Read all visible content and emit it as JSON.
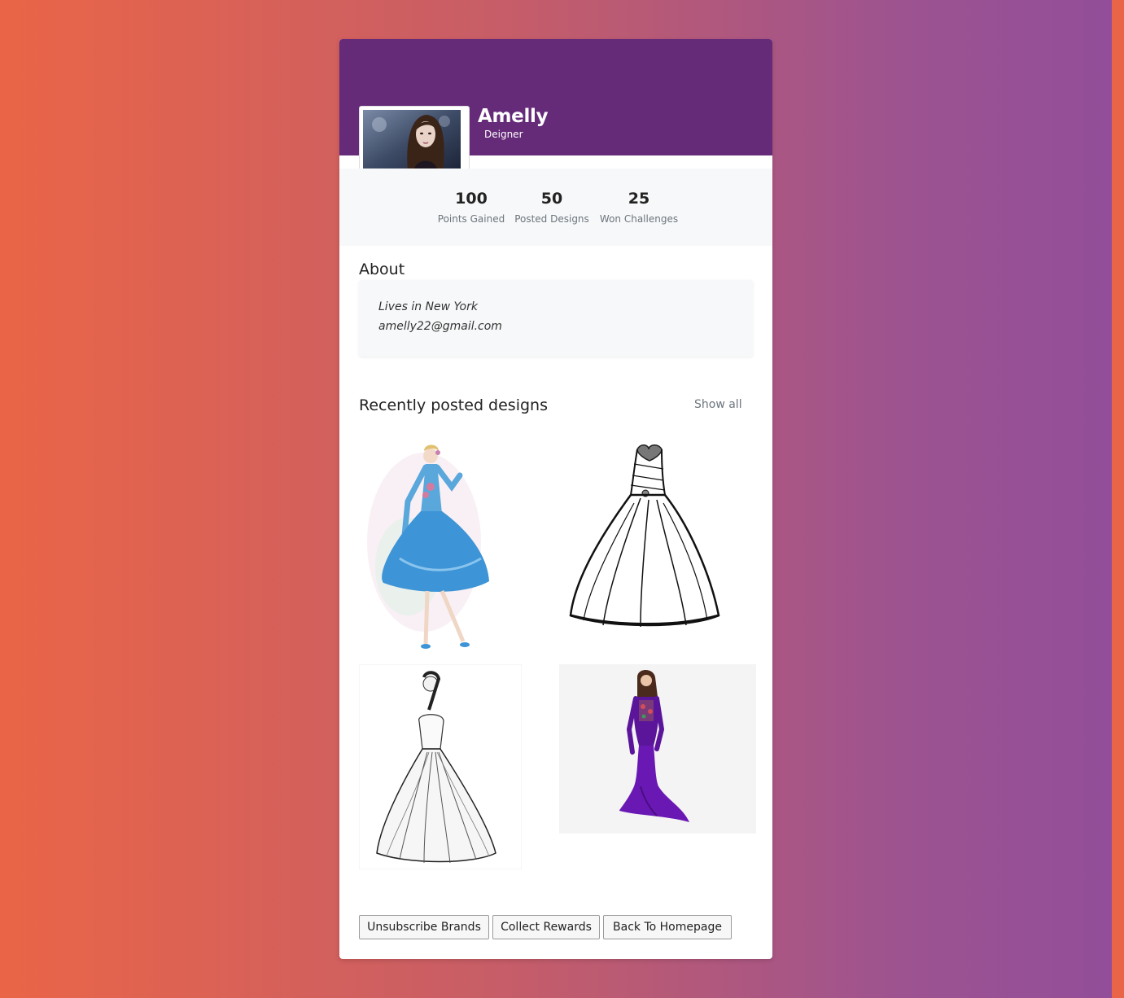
{
  "profile": {
    "name": "Amelly",
    "role": "Deigner"
  },
  "stats": [
    {
      "value": "100",
      "label": "Points Gained"
    },
    {
      "value": "50",
      "label": "Posted Designs"
    },
    {
      "value": "25",
      "label": "Won Challenges"
    }
  ],
  "about": {
    "title": "About",
    "location": "Lives in New York",
    "email": "amelly22@gmail.com"
  },
  "recent": {
    "title": "Recently posted designs",
    "show_all": "Show all"
  },
  "buttons": {
    "unsubscribe": "Unsubscribe Brands",
    "rewards": "Collect Rewards",
    "home": "Back To Homepage"
  },
  "colors": {
    "header": "#652a78",
    "background_left": "#ea6547",
    "background_right": "#924e99"
  }
}
